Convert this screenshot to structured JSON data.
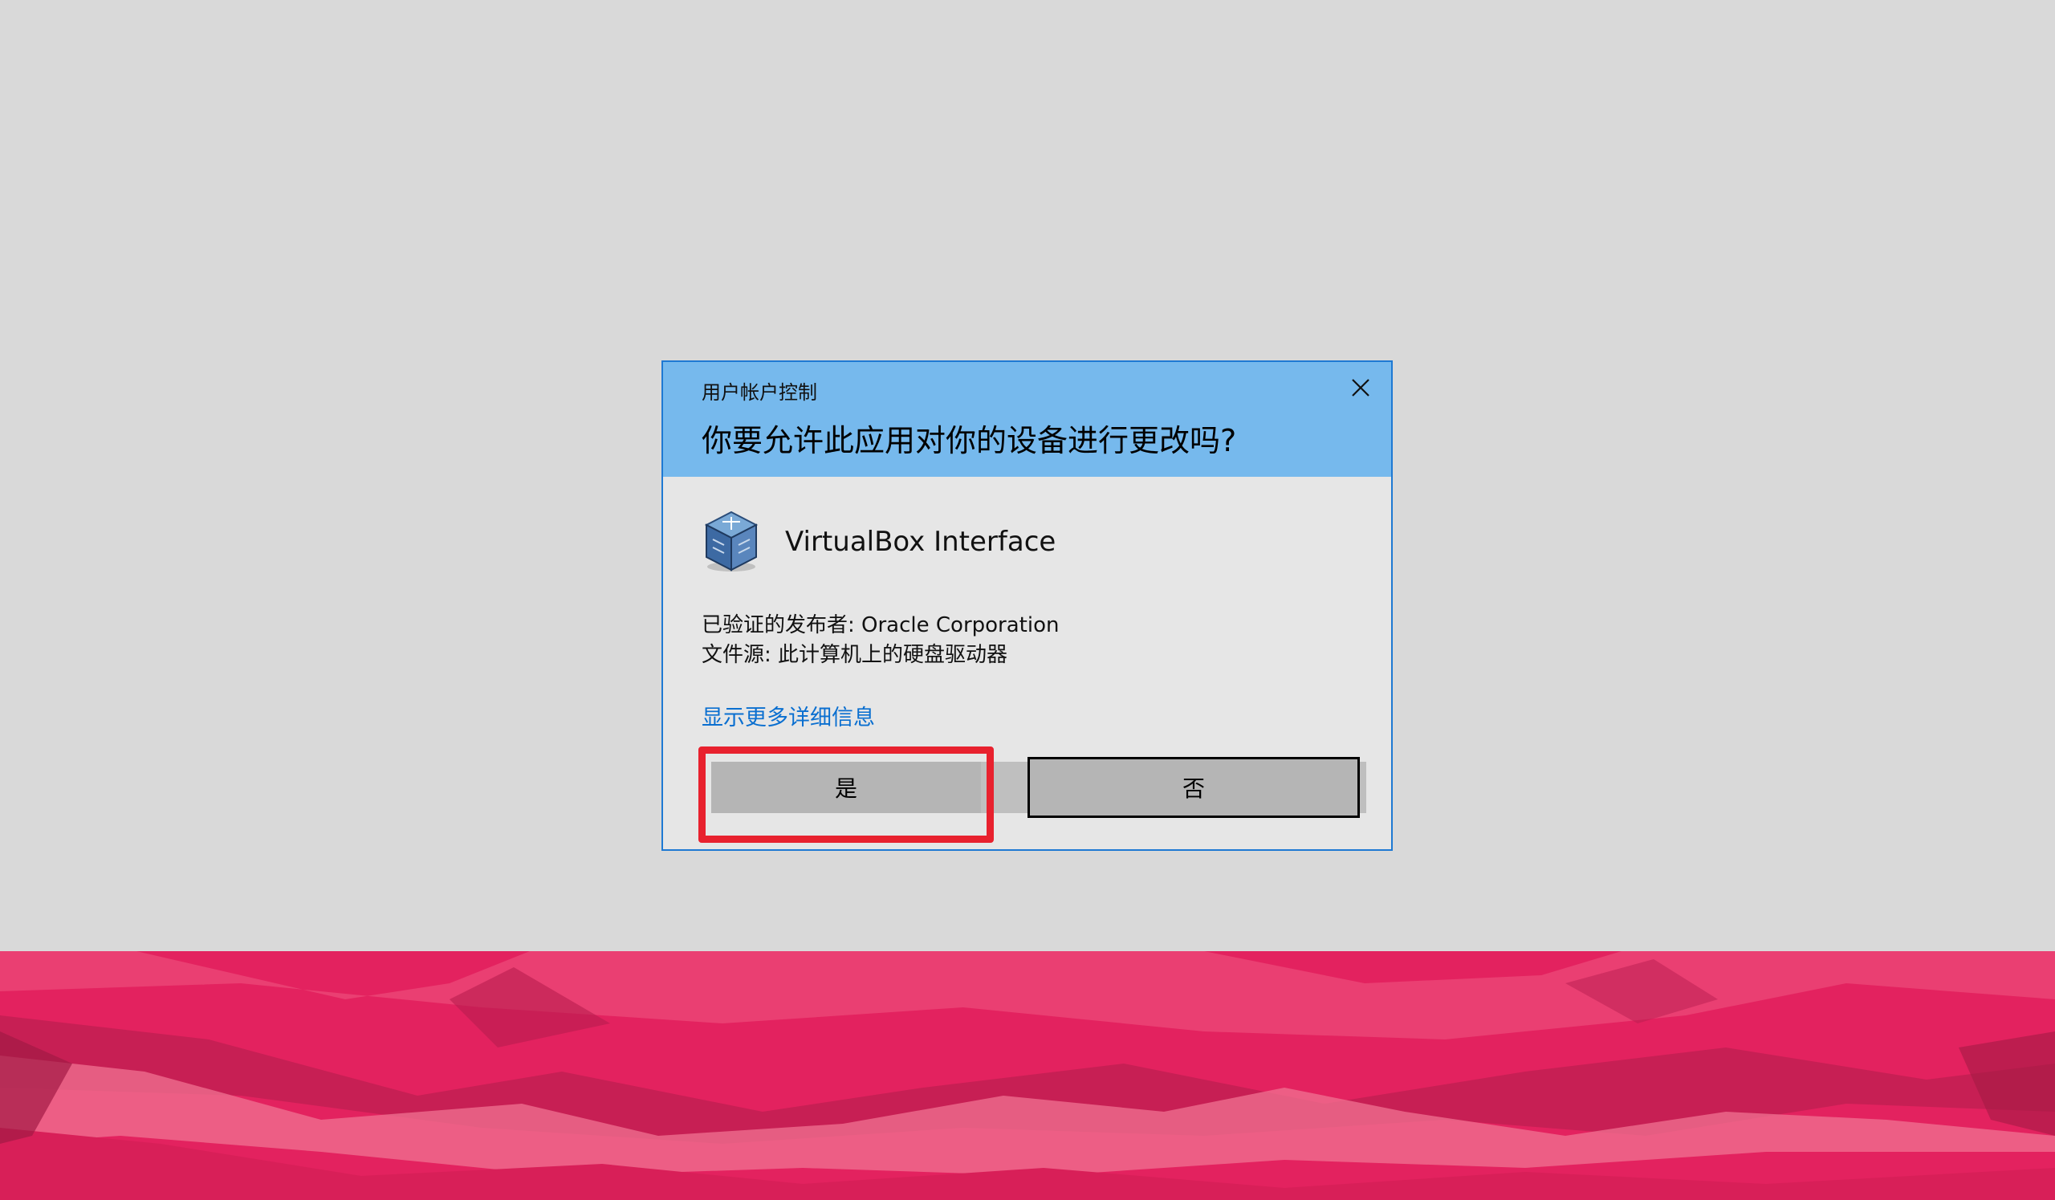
{
  "dialog": {
    "window_title": "用户帐户控制",
    "question": "你要允许此应用对你的设备进行更改吗?",
    "app": {
      "name": "VirtualBox Interface",
      "icon": "virtualbox-cube-icon"
    },
    "publisher_line": "已验证的发布者: Oracle Corporation",
    "source_line": "文件源: 此计算机上的硬盘驱动器",
    "details_link": "显示更多详细信息",
    "yes_label": "是",
    "no_label": "否",
    "close_icon": "close-icon"
  },
  "colors": {
    "header": "#76b9ed",
    "dialog_border": "#1e79d3",
    "dialog_body": "#e6e6e6",
    "link": "#0a6fd0",
    "highlight": "#e8212e",
    "desktop": "#d9d9d9",
    "wallpaper_pink": "#e3225f"
  }
}
